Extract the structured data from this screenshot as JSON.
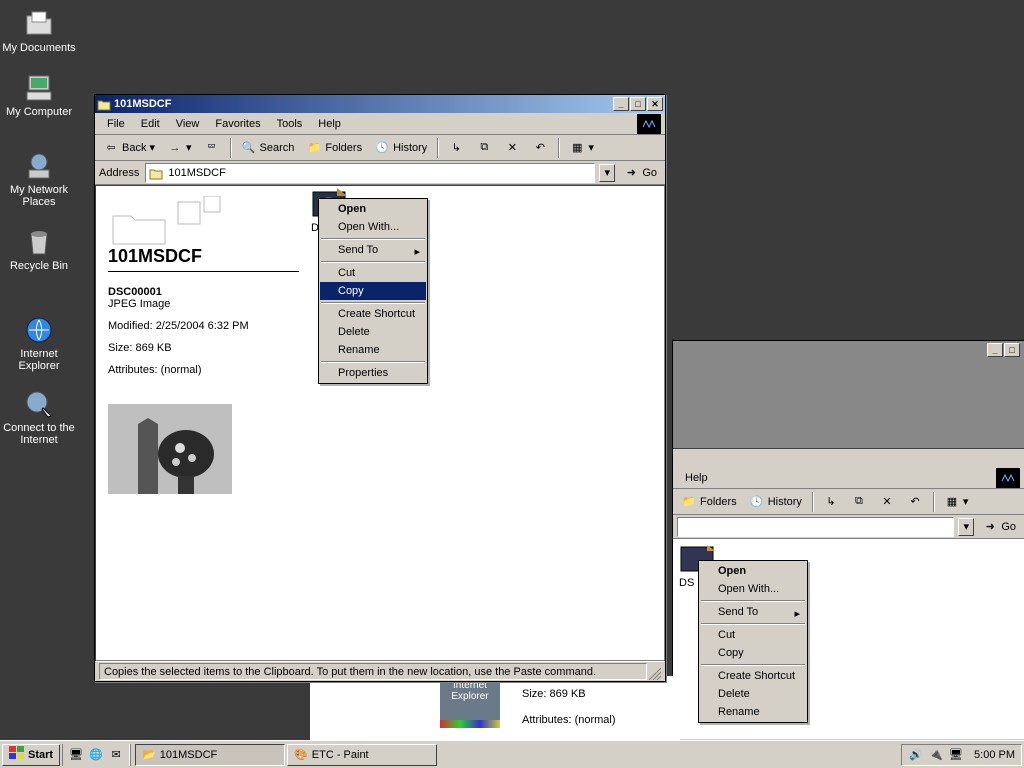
{
  "desktop": {
    "icons": [
      {
        "label": "My Documents"
      },
      {
        "label": "My Computer"
      },
      {
        "label": "My Network Places"
      },
      {
        "label": "Recycle Bin"
      },
      {
        "label": "Internet Explorer"
      },
      {
        "label": "Connect to the Internet"
      }
    ]
  },
  "window1": {
    "title": "101MSDCF",
    "menus": [
      "File",
      "Edit",
      "View",
      "Favorites",
      "Tools",
      "Help"
    ],
    "toolbar": {
      "back": "Back",
      "search": "Search",
      "folders": "Folders",
      "history": "History"
    },
    "address_label": "Address",
    "address_value": "101MSDCF",
    "go_label": "Go",
    "info": {
      "folder_name": "101MSDCF",
      "file_name": "DSC00001",
      "file_type": "JPEG Image",
      "modified_line": "Modified: 2/25/2004 6:32 PM",
      "size_line": "Size: 869 KB",
      "attributes_line": "Attributes: (normal)"
    },
    "file_label_partial": "D",
    "status": "Copies the selected items to the Clipboard. To put them in the new location, use the Paste command."
  },
  "context_menu": {
    "items": [
      {
        "label": "Open",
        "bold": true
      },
      {
        "label": "Open With..."
      },
      {
        "sep": true
      },
      {
        "label": "Send To",
        "arrow": true
      },
      {
        "sep": true
      },
      {
        "label": "Cut"
      },
      {
        "label": "Copy",
        "highlight": true
      },
      {
        "sep": true
      },
      {
        "label": "Create Shortcut"
      },
      {
        "label": "Delete"
      },
      {
        "label": "Rename"
      },
      {
        "sep": true
      },
      {
        "label": "Properties"
      }
    ]
  },
  "window2": {
    "menus_visible": [
      "Help"
    ],
    "toolbar": {
      "folders": "Folders",
      "history": "History"
    },
    "go_label": "Go",
    "file_label_partial": "DS",
    "info_fragment": {
      "ie_label": "Internet Explorer",
      "size_line": "Size: 869 KB",
      "attributes_line": "Attributes: (normal)"
    }
  },
  "context_menu2": {
    "items": [
      {
        "label": "Open",
        "bold": true
      },
      {
        "label": "Open With..."
      },
      {
        "sep": true
      },
      {
        "label": "Send To",
        "arrow": true
      },
      {
        "sep": true
      },
      {
        "label": "Cut"
      },
      {
        "label": "Copy"
      },
      {
        "sep": true
      },
      {
        "label": "Create Shortcut"
      },
      {
        "label": "Delete"
      },
      {
        "label": "Rename"
      }
    ]
  },
  "taskbar": {
    "start": "Start",
    "tasks": [
      {
        "label": "101MSDCF",
        "active": true
      },
      {
        "label": "ETC - Paint",
        "active": false
      }
    ],
    "clock": "5:00 PM"
  }
}
